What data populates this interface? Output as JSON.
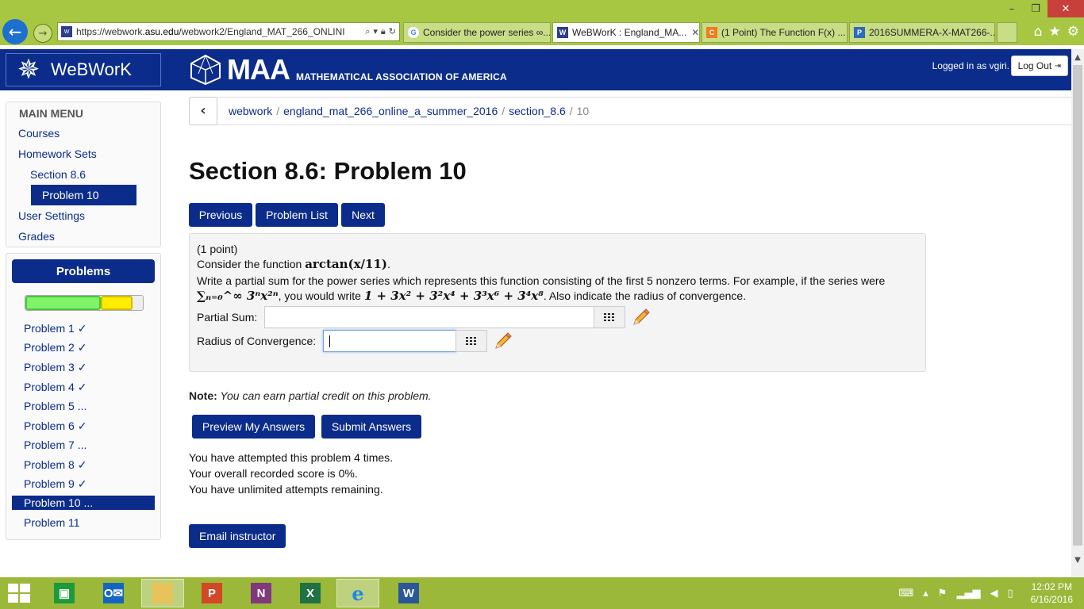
{
  "browser": {
    "url_prefix": "https://webwork.",
    "url_domain": "asu.edu",
    "url_path": "/webwork2/England_MAT_266_ONLINI",
    "tabs": [
      {
        "label": "Consider the power series ∞...",
        "icon": "google-icon",
        "active": false
      },
      {
        "label": "WeBWorK : England_MA...",
        "icon": "webwork-favicon",
        "active": true
      },
      {
        "label": "(1 Point) The Function F(x) ...",
        "icon": "chegg-icon",
        "active": false
      },
      {
        "label": "2016SUMMERA-X-MAT266-...",
        "icon": "pearson-icon",
        "active": false
      }
    ]
  },
  "header": {
    "app_name": "WeBWorK",
    "maa_big": "MAA",
    "maa_sub": "MATHEMATICAL ASSOCIATION OF AMERICA",
    "logged_in": "Logged in as vgiri.",
    "logout": "Log Out"
  },
  "main_menu": {
    "title": "MAIN MENU",
    "courses": "Courses",
    "homework_sets": "Homework Sets",
    "section": "Section 8.6",
    "problem": "Problem 10",
    "user_settings": "User Settings",
    "grades": "Grades"
  },
  "problems_panel": {
    "title": "Problems",
    "progress_green_fraction": 0.64,
    "progress_yellow_fraction": 0.27,
    "items": [
      {
        "label": "Problem 1 ✓"
      },
      {
        "label": "Problem 2 ✓"
      },
      {
        "label": "Problem 3 ✓"
      },
      {
        "label": "Problem 4 ✓"
      },
      {
        "label": "Problem 5 ..."
      },
      {
        "label": "Problem 6 ✓"
      },
      {
        "label": "Problem 7 ..."
      },
      {
        "label": "Problem 8 ✓"
      },
      {
        "label": "Problem 9 ✓"
      },
      {
        "label": "Problem 10 ..."
      },
      {
        "label": "Problem 11"
      }
    ]
  },
  "breadcrumb": {
    "c1": "webwork",
    "c2": "england_mat_266_online_a_summer_2016",
    "c3": "section_8.6",
    "c4": "10"
  },
  "page": {
    "title": "Section 8.6: Problem 10",
    "previous": "Previous",
    "problem_list": "Problem List",
    "next": "Next"
  },
  "problem": {
    "points": "(1 point)",
    "consider_prefix": "Consider the function ",
    "function": "arctan(x/11)",
    "consider_suffix": ".",
    "instruction": "Write a partial sum for the power series which represents this function consisting of the first 5 nonzero terms. For example, if the series were",
    "example_series": "∑ₙ₌₀^∞ 3ⁿx²ⁿ",
    "example_mid": ", you would write ",
    "example_answer": "1 + 3x² + 3²x⁴ + 3³x⁶ + 3⁴x⁸",
    "example_suffix": ". Also indicate the radius of convergence.",
    "partial_sum_label": "Partial Sum:",
    "partial_sum_value": "",
    "radius_label": "Radius of Convergence:",
    "radius_value": ""
  },
  "note": {
    "label": "Note:",
    "text": " You can earn partial credit on this problem."
  },
  "actions": {
    "preview": "Preview My Answers",
    "submit": "Submit Answers",
    "email": "Email instructor"
  },
  "status": {
    "attempts": "You have attempted this problem 4 times.",
    "score": "Your overall recorded score is 0%.",
    "remaining": "You have unlimited attempts remaining."
  },
  "taskbar": {
    "time": "12:02 PM",
    "date": "6/16/2016"
  },
  "colors": {
    "brand_navy": "#0b2c8a",
    "chrome_green": "#a7c742",
    "taskbar_green": "#9bb83a"
  }
}
